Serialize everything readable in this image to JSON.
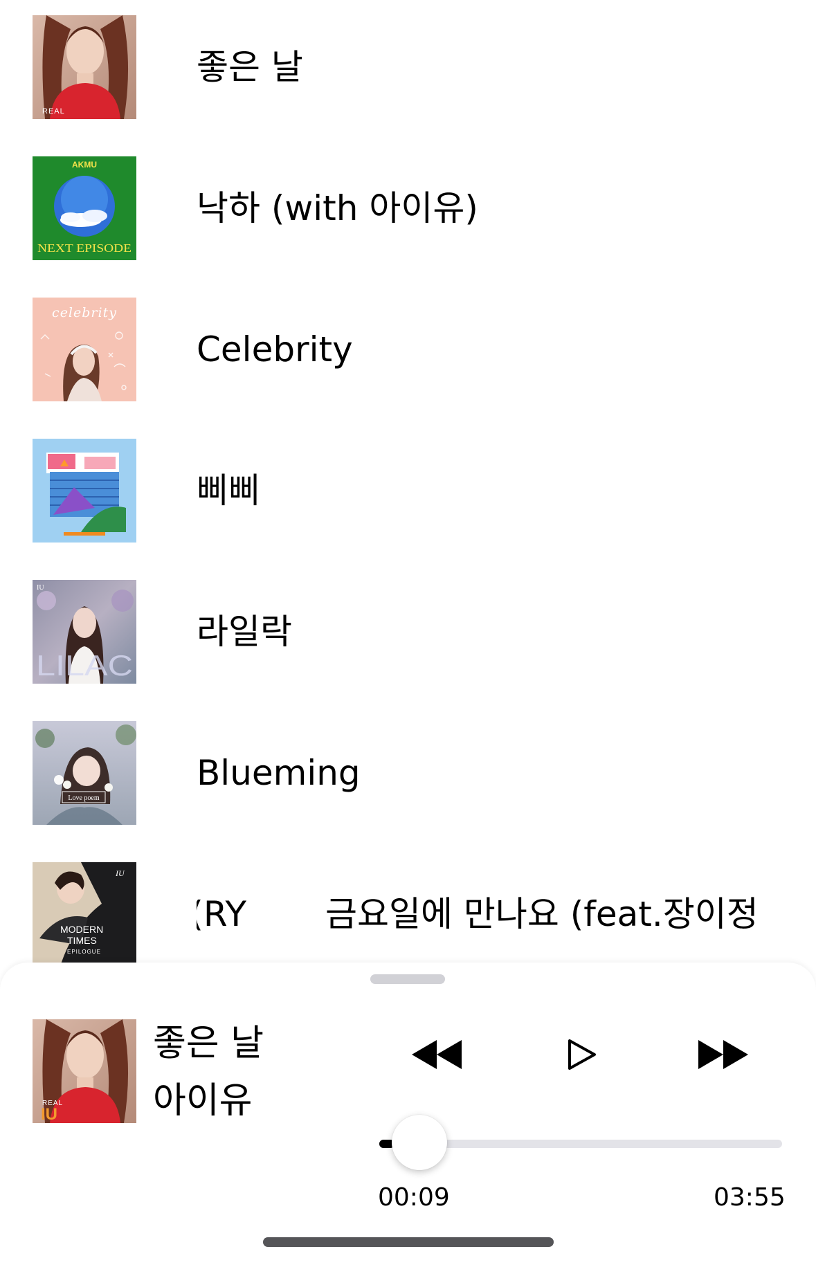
{
  "songs": [
    {
      "title": "좋은 날",
      "cover": "IU REAL album cover"
    },
    {
      "title": "낙하 (with 아이유)",
      "cover": "AKMU NEXT EPISODE album cover"
    },
    {
      "title": "Celebrity",
      "cover": "Celebrity album cover"
    },
    {
      "title": "삐삐",
      "cover": "BBIBBI album cover"
    },
    {
      "title": "라일락",
      "cover": "LILAC album cover"
    },
    {
      "title": "Blueming",
      "cover": "Love poem album cover"
    },
    {
      "title_tail": "RY)",
      "title_head": "금요일에 만나요 (feat.장이정 o",
      "cover": "MODERN TIMES EPILOGUE album cover"
    }
  ],
  "cover_text": {
    "real": "REAL",
    "akmu": "AKMU",
    "next_episode": "NEXT EPISODE",
    "celebrity": "celebrity",
    "lilac": "LILAC",
    "love_poem": "Love poem",
    "modern": "MODERN",
    "times": "TIMES",
    "epilogue": "EPILOGUE",
    "iu": "IU"
  },
  "player": {
    "title": "좋은 날",
    "artist": "아이유",
    "elapsed": "00:09",
    "duration": "03:55",
    "progress_fraction": 0.038,
    "controls": [
      "rewind-icon",
      "play-icon",
      "fast-forward-icon"
    ]
  },
  "colors": {
    "text": "#000000",
    "track": "#e3e3e8",
    "grabber": "#d1d1d6",
    "home_indicator": "#555558"
  }
}
